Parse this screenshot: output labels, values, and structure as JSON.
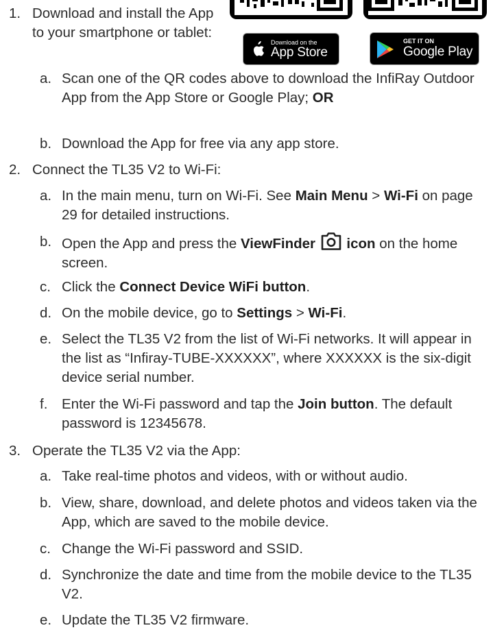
{
  "badges": {
    "app_store": {
      "small": "Download on the",
      "big": "App Store"
    },
    "google_play": {
      "small": "GET IT ON",
      "big": "Google Play"
    }
  },
  "steps": [
    {
      "num": "1.",
      "title": "Download and install the App to your smartphone or tablet:",
      "subs": [
        {
          "letter": "a.",
          "text": "Scan one of the QR codes above to download the InfiRay Outdoor App from the App Store or Google Play;",
          "bold_tail": "OR"
        },
        {
          "letter": "b.",
          "text": "Download the App for free via any app store."
        }
      ]
    },
    {
      "num": "2.",
      "title": "Connect the TL35 V2 to Wi-Fi:",
      "subs": [
        {
          "letter": "a.",
          "pre": "In the main menu, turn on Wi-Fi. See ",
          "bold1": "Main Menu",
          "mid": " > ",
          "bold2": "Wi-Fi",
          "post": " on page 29 for detailed instructions."
        },
        {
          "letter": "b.",
          "pre": "Open the App and press the ",
          "bold1": "ViewFinder",
          "bold2": "icon",
          "post": " on the home screen."
        },
        {
          "letter": "c.",
          "pre": "Click the ",
          "bold1": "Connect Device WiFi button",
          "post": "."
        },
        {
          "letter": "d.",
          "pre": "On the mobile device, go to ",
          "bold1": "Settings",
          "mid": " > ",
          "bold2": "Wi-Fi",
          "post": "."
        },
        {
          "letter": "e.",
          "text": "Select the TL35 V2 from the list of Wi-Fi networks. It will appear in the list as “Infiray-TUBE-XXXXXX”, where XXXXXX is the six-digit device serial number."
        },
        {
          "letter": "f.",
          "pre": "Enter the Wi-Fi password and tap the ",
          "bold1": "Join button",
          "post": ". The default password is 12345678."
        }
      ]
    },
    {
      "num": "3.",
      "title": "Operate the TL35 V2 via the App:",
      "subs": [
        {
          "letter": "a.",
          "text": "Take real-time photos and videos, with or without audio."
        },
        {
          "letter": "b.",
          "text": "View, share, download, and delete photos and videos taken via the App, which are saved to the mobile device."
        },
        {
          "letter": "c.",
          "text": "Change the Wi-Fi password and SSID."
        },
        {
          "letter": "d.",
          "text": "Synchronize the date and time from the mobile device to the TL35 V2."
        },
        {
          "letter": "e.",
          "text": "Update the TL35 V2 firmware."
        }
      ]
    }
  ]
}
